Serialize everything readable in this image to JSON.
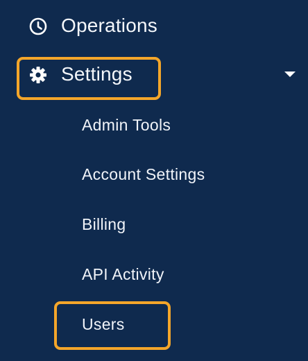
{
  "nav": {
    "operations": {
      "label": "Operations",
      "icon": "clock-icon"
    },
    "settings": {
      "label": "Settings",
      "icon": "gear-icon",
      "expanded": true,
      "submenu": [
        {
          "label": "Admin Tools"
        },
        {
          "label": "Account Settings"
        },
        {
          "label": "Billing"
        },
        {
          "label": "API Activity"
        },
        {
          "label": "Users"
        }
      ]
    }
  },
  "colors": {
    "background": "#0f2a4e",
    "text": "#f2f5fa",
    "highlight": "#f4a62a"
  }
}
